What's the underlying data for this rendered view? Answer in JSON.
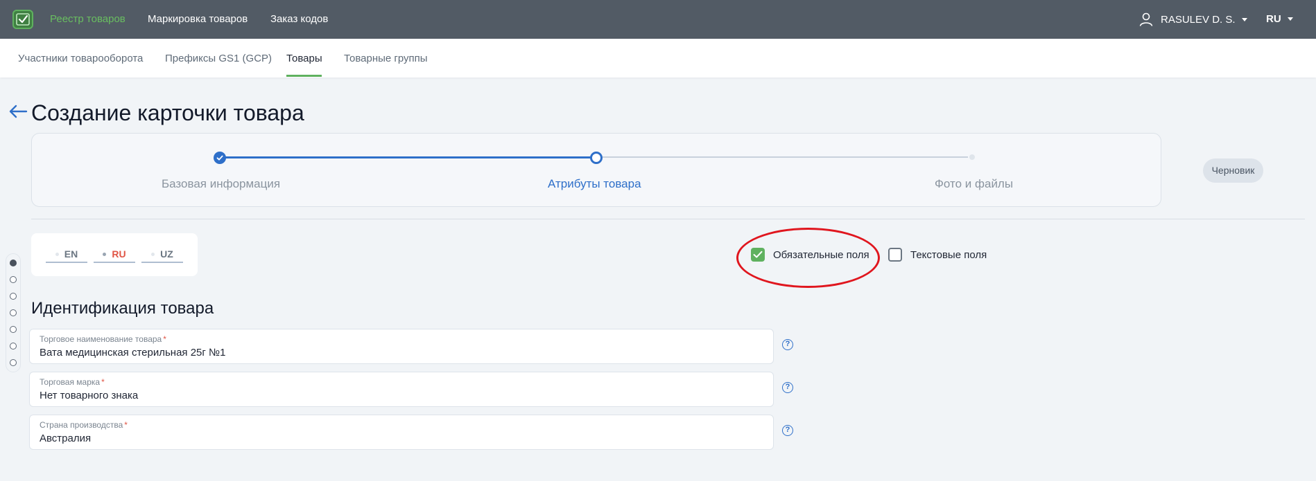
{
  "topbar": {
    "nav": [
      {
        "label": "Реестр товаров",
        "active": true
      },
      {
        "label": "Маркировка товаров",
        "active": false
      },
      {
        "label": "Заказ кодов",
        "active": false
      }
    ],
    "user": {
      "name": "RASULEV D. S.",
      "icon": "user-icon"
    },
    "language": "RU"
  },
  "subnav": {
    "tabs": [
      {
        "label": "Участники товарооборота",
        "active": false
      },
      {
        "label": "Префиксы GS1 (GCP)",
        "active": false
      },
      {
        "label": "Товары",
        "active": true
      },
      {
        "label": "Товарные группы",
        "active": false
      }
    ]
  },
  "page": {
    "title": "Создание карточки товара",
    "status_badge": "Черновик"
  },
  "stepper": {
    "steps": [
      {
        "label": "Базовая информация",
        "state": "done"
      },
      {
        "label": "Атрибуты товара",
        "state": "current"
      },
      {
        "label": "Фото и файлы",
        "state": "todo"
      }
    ]
  },
  "languages": {
    "tabs": [
      {
        "label": "EN",
        "active": false
      },
      {
        "label": "RU",
        "active": true
      },
      {
        "label": "UZ",
        "active": false
      }
    ]
  },
  "filters": {
    "required_fields": {
      "label": "Обязательные поля",
      "checked": true
    },
    "text_fields": {
      "label": "Текстовые поля",
      "checked": false
    }
  },
  "section": {
    "title": "Идентификация товара",
    "fields": [
      {
        "label": "Торговое наименование товара",
        "required_mark": "*",
        "value": "Вата медицинская стерильная 25г №1"
      },
      {
        "label": "Торговая марка",
        "required_mark": "*",
        "value": "Нет товарного знака"
      },
      {
        "label": "Страна производства",
        "required_mark": "*",
        "value": "Австралия"
      }
    ],
    "help_glyph": "?"
  },
  "side_nav": {
    "count": 7,
    "active_index": 0
  },
  "colors": {
    "topbar": "#525b65",
    "accent_green": "#5fb15f",
    "accent_blue": "#2e6fc9",
    "active_lang": "#e05546",
    "annotation_red": "#e0161e"
  }
}
